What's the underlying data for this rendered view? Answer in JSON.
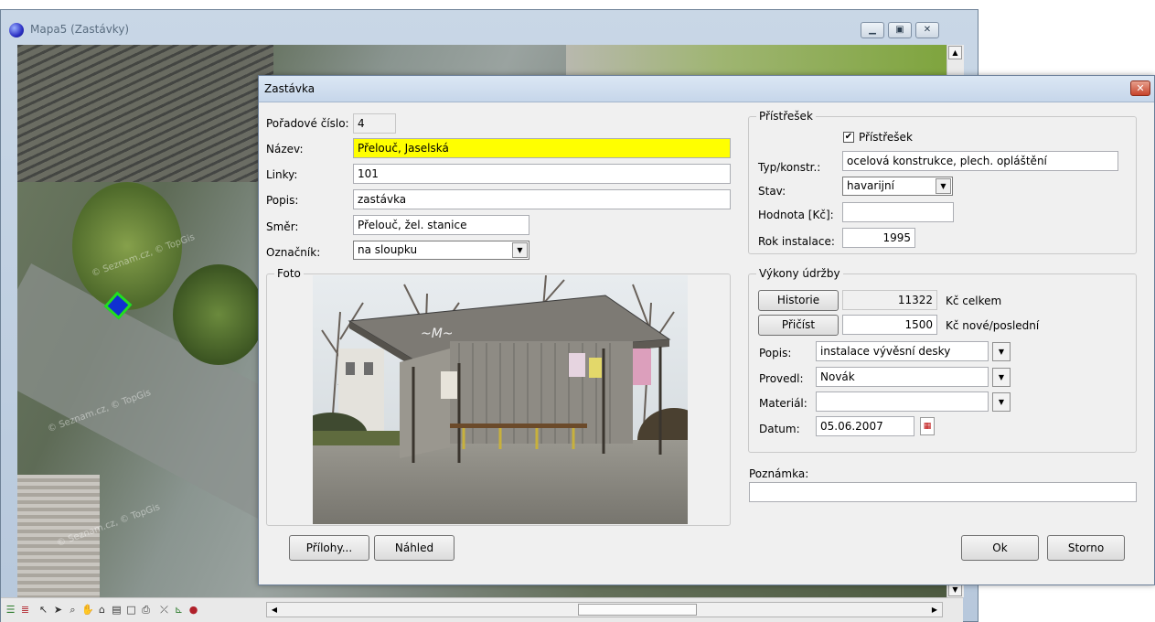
{
  "map_window": {
    "title": "Mapa5 (Zastávky)",
    "watermarks": [
      "© Seznam.cz, © TopGis",
      "© Seznam.cz, © TopGis",
      "© Seznam.cz, © TopGis"
    ]
  },
  "dialog": {
    "title": "Zastávka",
    "close_label": "✕",
    "fields": {
      "poradove_cislo": {
        "label": "Pořadové číslo:",
        "value": "4"
      },
      "nazev": {
        "label": "Název:",
        "value": "Přelouč, Jaselská"
      },
      "linky": {
        "label": "Linky:",
        "value": "101"
      },
      "popis": {
        "label": "Popis:",
        "value": "zastávka"
      },
      "smer": {
        "label": "Směr:",
        "value": "Přelouč, žel. stanice"
      },
      "oznacnik": {
        "label": "Označník:",
        "value": "na sloupku"
      }
    },
    "foto_legend": "Foto",
    "pristresek": {
      "legend": "Přístřešek",
      "checkbox_label": "Přístřešek",
      "checked": true,
      "typ": {
        "label": "Typ/konstr.:",
        "value": "ocelová konstrukce, plech. opláštění"
      },
      "stav": {
        "label": "Stav:",
        "value": "havarijní"
      },
      "hodnota": {
        "label": "Hodnota [Kč]:",
        "value": ""
      },
      "rok": {
        "label": "Rok instalace:",
        "value": "1995"
      }
    },
    "udrzba": {
      "legend": "Výkony údržby",
      "historie_button": "Historie",
      "historie_value": "11322",
      "historie_unit": "Kč celkem",
      "pricist_button": "Přičíst",
      "pricist_value": "1500",
      "pricist_unit": "Kč nové/poslední",
      "popis": {
        "label": "Popis:",
        "value": "instalace vývěsní desky"
      },
      "provedl": {
        "label": "Provedl:",
        "value": "Novák"
      },
      "material": {
        "label": "Materiál:",
        "value": ""
      },
      "datum": {
        "label": "Datum:",
        "value": "05.06.2007"
      }
    },
    "poznamka": {
      "label": "Poznámka:",
      "value": ""
    },
    "buttons": {
      "prilohy": "Přílohy...",
      "nahled": "Náhled",
      "ok": "Ok",
      "storno": "Storno"
    }
  }
}
